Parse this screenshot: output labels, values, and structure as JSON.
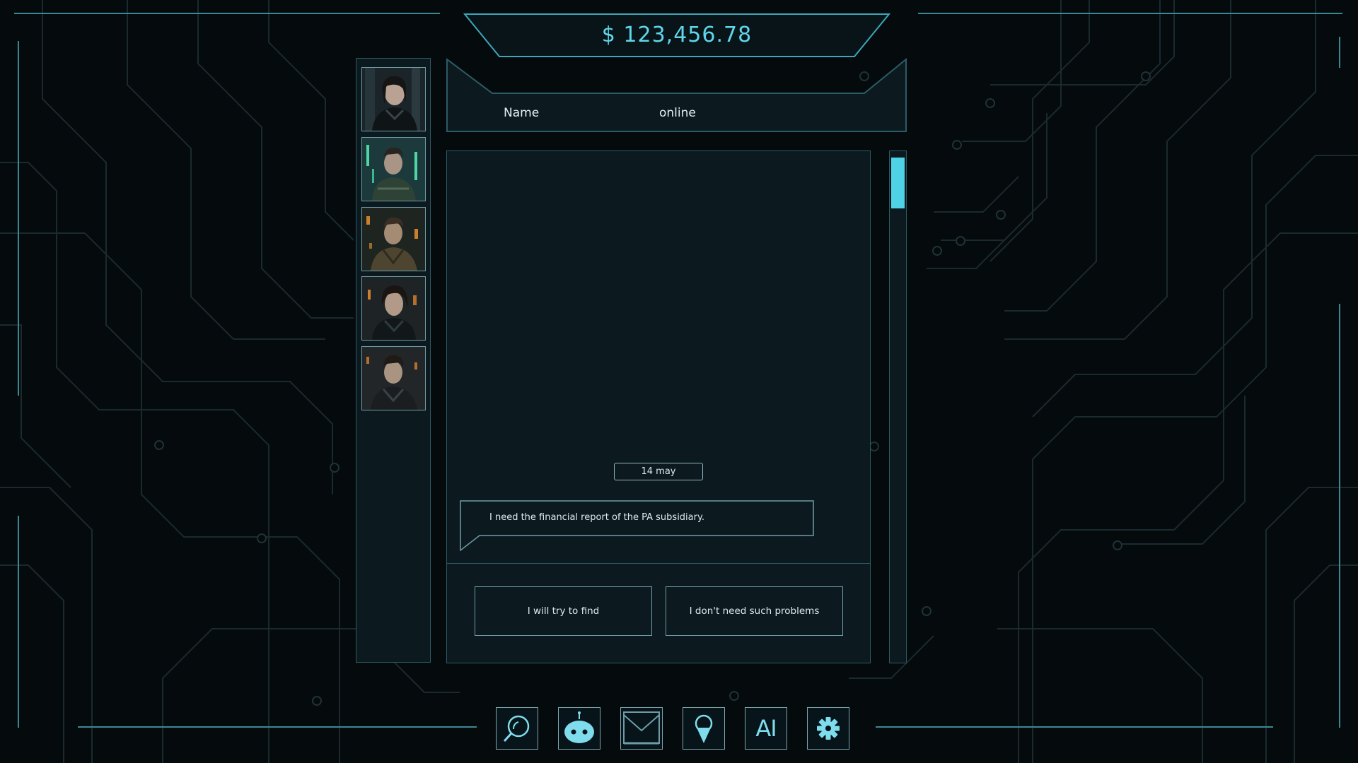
{
  "balance": {
    "amount": "$ 123,456.78"
  },
  "contacts": [
    {
      "avatar": "woman-dark-hair-leather-jacket"
    },
    {
      "avatar": "man-cyborg-green-armor"
    },
    {
      "avatar": "man-brown-jacket"
    },
    {
      "avatar": "woman-dark-jacket"
    },
    {
      "avatar": "man-dark-jacket"
    }
  ],
  "chat": {
    "name": "Name",
    "status": "online",
    "date": "14 may",
    "messages": [
      {
        "text": "I need the financial report of the PA subsidiary."
      }
    ],
    "replies": [
      {
        "label": "I will try to find"
      },
      {
        "label": "I don't need such problems"
      }
    ],
    "scroll_position": 0
  },
  "dock": {
    "items": [
      {
        "icon": "search-icon"
      },
      {
        "icon": "robot-icon"
      },
      {
        "icon": "mail-icon"
      },
      {
        "icon": "location-pin-icon"
      },
      {
        "icon": "ai-icon",
        "label": "AI"
      },
      {
        "icon": "gear-icon"
      }
    ]
  },
  "colors": {
    "accent": "#4fd1e6",
    "panel": "#0c1a1f",
    "background": "#050a0c",
    "border": "#2c5b66"
  }
}
